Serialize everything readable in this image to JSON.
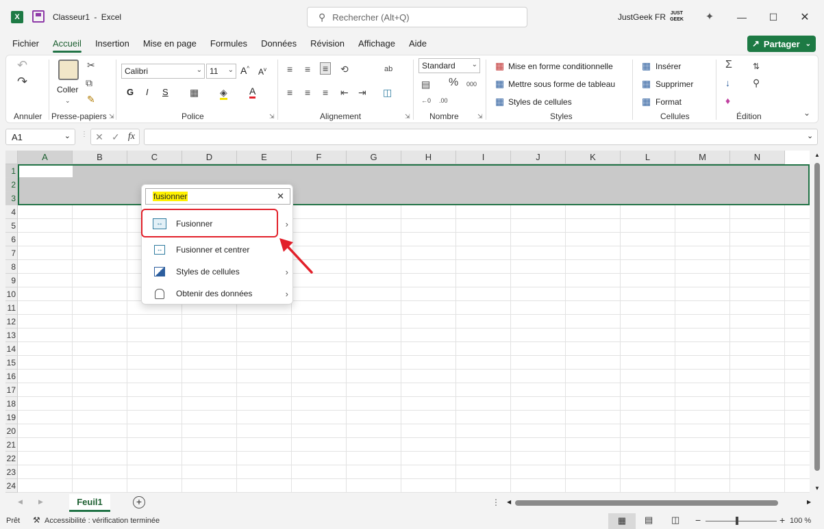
{
  "window": {
    "doc_title": "Classeur1",
    "separator": "-",
    "app_name": "Excel",
    "user_name": "JustGeek FR",
    "logo_text": "JUST GEEK"
  },
  "search": {
    "placeholder": "Rechercher (Alt+Q)"
  },
  "menu": {
    "tabs": [
      "Fichier",
      "Accueil",
      "Insertion",
      "Mise en page",
      "Formules",
      "Données",
      "Révision",
      "Affichage",
      "Aide"
    ],
    "share_label": "Partager"
  },
  "ribbon": {
    "groups": {
      "undo": "Annuler",
      "clipboard": "Presse-papiers",
      "font": "Police",
      "alignment": "Alignement",
      "number": "Nombre",
      "styles": "Styles",
      "cells": "Cellules",
      "editing": "Édition"
    },
    "paste_label": "Coller",
    "font_name": "Calibri",
    "font_size": "11",
    "bold": "G",
    "italic": "I",
    "underline": "S",
    "number_format": "Standard",
    "conditional_format": "Mise en forme conditionnelle",
    "format_as_table": "Mettre sous forme de tableau",
    "cell_styles": "Styles de cellules",
    "insert": "Insérer",
    "delete": "Supprimer",
    "format": "Format"
  },
  "formula_bar": {
    "name_box": "A1",
    "fx": "fx",
    "value": ""
  },
  "grid": {
    "columns": [
      "A",
      "B",
      "C",
      "D",
      "E",
      "F",
      "G",
      "H",
      "I",
      "J",
      "K",
      "L",
      "M",
      "N"
    ],
    "rows": [
      "1",
      "2",
      "3",
      "4",
      "5",
      "6",
      "7",
      "8",
      "9",
      "10",
      "11",
      "12",
      "13",
      "14",
      "15",
      "16",
      "17",
      "18",
      "19",
      "20",
      "21",
      "22",
      "23",
      "24"
    ]
  },
  "popup": {
    "search_value": "fusionner",
    "items": [
      {
        "label": "Fusionner",
        "icon": "merge-icon"
      },
      {
        "label": "Fusionner et centrer",
        "icon": "merge-center-icon"
      },
      {
        "label": "Styles de cellules",
        "icon": "cell-styles-icon"
      },
      {
        "label": "Obtenir des données",
        "icon": "get-data-icon"
      }
    ]
  },
  "sheets": {
    "active": "Feuil1"
  },
  "status": {
    "ready": "Prêt",
    "accessibility": "Accessibilité : vérification terminée",
    "zoom": "100 %"
  },
  "colors": {
    "accent": "#217346",
    "highlight": "#e2202a",
    "search_highlight": "#fff200"
  }
}
